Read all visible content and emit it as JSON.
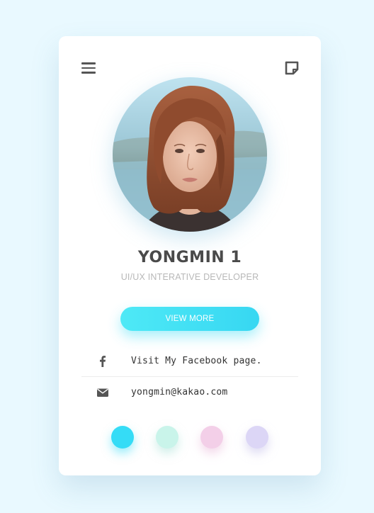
{
  "profile": {
    "name": "YONGMIN 1",
    "role": "UI/UX INTERATIVE DEVELOPER",
    "view_more_label": "VIEW MORE"
  },
  "contacts": [
    {
      "icon": "facebook-icon",
      "text": "Visit My Facebook page."
    },
    {
      "icon": "mail-icon",
      "text": "yongmin@kakao.com"
    }
  ],
  "theme_colors": [
    "#35dcf6",
    "#c9f4ea",
    "#f3cfe8",
    "#dcd6f6"
  ],
  "accent": "#3fe2f5"
}
